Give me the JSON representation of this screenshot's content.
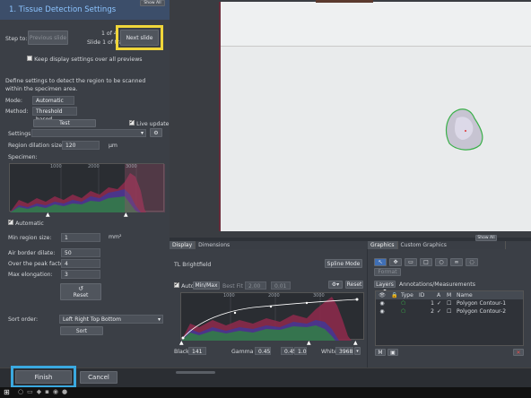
{
  "left_panel": {
    "title": "1. Tissue Detection Settings",
    "show_all": "Show All",
    "step_to_label": "Step to:",
    "prev_slide": "Previous slide",
    "slide_count": "1 of 4",
    "slide_info": "Slide 1 of tray 1",
    "next_slide": "Next slide",
    "keep_display": "Keep display settings over all previews",
    "description": "Define settings to detect the region to be scanned within the specimen area.",
    "mode_label": "Mode:",
    "mode_value": "Automatic",
    "method_label": "Method:",
    "method_value": "Threshold based",
    "test_button": "Test",
    "live_update": "Live update",
    "settings_label": "Settings",
    "dilation_label": "Region dilation size:",
    "dilation_value": "120",
    "dilation_unit": "μm",
    "specimen_label": "Specimen:",
    "hist_ticks": [
      "1000",
      "2000",
      "3000"
    ],
    "automatic_label": "Automatic",
    "min_region_label": "Min region size:",
    "min_region_value": "1",
    "min_region_unit": "mm²",
    "air_border_label": "Air border dilate:",
    "air_border_value": "50",
    "peak_factor_label": "Over the peak factor:",
    "peak_factor_value": "4",
    "max_elong_label": "Max elongation:",
    "max_elong_value": "3",
    "reset_button": "Reset",
    "sort_order_label": "Sort order:",
    "sort_order_value": "Left Right Top Bottom",
    "sort_button": "Sort"
  },
  "footer": {
    "finish": "Finish",
    "cancel": "Cancel"
  },
  "display_panel": {
    "tabs": [
      "Display",
      "Dimensions"
    ],
    "channel_name": "TL Brightfield",
    "spline_mode": "Spline Mode",
    "auto_label": "Auto",
    "min_max": "Min/Max",
    "best_fit": "Best Fit",
    "val_a": "2.00",
    "val_b": "0.01",
    "reset": "Reset",
    "hist_ticks": [
      "1000",
      "2000",
      "3000"
    ],
    "black_label": "Black",
    "black_value": "141",
    "gamma_label": "Gamma",
    "gamma_value": "0.45",
    "gamma_min": "0.45",
    "gamma_max": "1.0",
    "white_label": "White",
    "white_value": "3968",
    "show_all": "Show All"
  },
  "graphics_panel": {
    "tabs": [
      "Graphics",
      "Custom Graphics"
    ],
    "format_label": "Format",
    "layers_label": "Layers",
    "annotations_label": "Annotations/Measurements",
    "columns": [
      "Type",
      "ID",
      "A",
      "M",
      "Name"
    ],
    "rows": [
      {
        "id": "1",
        "name": "Polygon Contour-1"
      },
      {
        "id": "2",
        "name": "Polygon Contour-2"
      }
    ]
  },
  "colors": {
    "accent_highlight": "#f0d63a",
    "finish_highlight": "#3aa9e0",
    "title_blue": "#5aa7e8",
    "contour_green": "#3bb04a"
  }
}
